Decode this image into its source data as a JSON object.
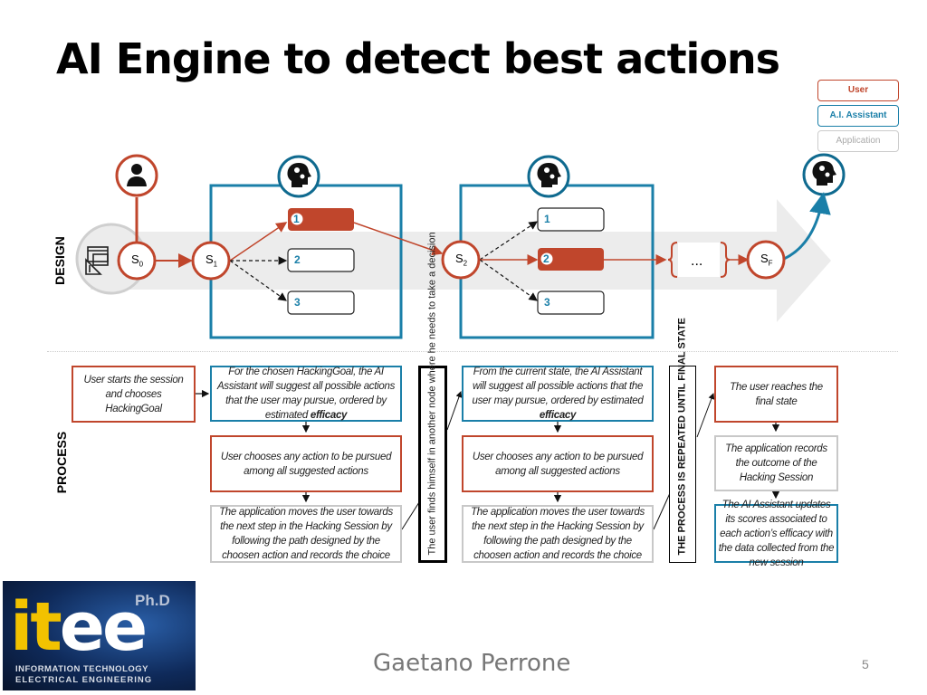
{
  "title": "AI Engine to detect best actions",
  "legend": [
    {
      "label": "User",
      "color": "#c0462c"
    },
    {
      "label": "A.I. Assistant",
      "color": "#1a7fa8"
    },
    {
      "label": "Application",
      "color": "#aaaaaa"
    }
  ],
  "colors": {
    "user": "#c0462c",
    "ai": "#1a7fa8",
    "app": "#c8c8c8",
    "band": "#ececec"
  },
  "design": {
    "label": "DESIGN",
    "states": {
      "s0": "S",
      "s0_sub": "0",
      "s1": "S",
      "s1_sub": "1",
      "s2": "S",
      "s2_sub": "2",
      "sf": "S",
      "sf_sub": "F"
    },
    "ellipsis": "...",
    "group1_actions": [
      "1",
      "2",
      "3"
    ],
    "group1_selected": "1",
    "group2_actions": [
      "1",
      "2",
      "3"
    ],
    "group2_selected": "2",
    "icons": {
      "user": "user-icon",
      "ai": "ai-brain-gears-icon",
      "design": "design-tools-icon"
    }
  },
  "process": {
    "label": "PROCESS",
    "start": "User starts the session and chooses HackingGoal",
    "col1": {
      "suggest_pre": "For the chosen HackingGoal, the AI Assistant will suggest all possible actions that the user may pursue, ordered by estimated ",
      "suggest_bold": "efficacy",
      "choose": "User chooses any action to be pursued among all suggested actions",
      "move": "The application moves the user towards the next step in the Hacking Session by following the path designed by the choosen action and records the choice"
    },
    "node_note": "The user finds himself in another node where he needs to take a decision",
    "col2": {
      "suggest_pre": "From the current state, the AI Assistant will suggest all possible actions that the user may pursue, ordered by estimated ",
      "suggest_bold": "efficacy",
      "choose": "User chooses any action to be pursued among all suggested actions",
      "move": "The application moves the user towards the next step in the Hacking Session by following the path designed by the choosen action and records the choice"
    },
    "repeat_note": "THE PROCESS IS REPEATED UNTIL FINAL STATE",
    "final": {
      "reach": "The user reaches the final state",
      "record": "The application records the outcome of the Hacking Session",
      "update": "The AI Assistant updates its scores associated to each action’s efficacy with the data collected from the new session"
    }
  },
  "logo": {
    "main": "itee",
    "badge": "Ph.D",
    "line1": "INFORMATION TECHNOLOGY",
    "line2": "ELECTRICAL ENGINEERING"
  },
  "footer": {
    "author": "Gaetano Perrone",
    "page": "5"
  }
}
